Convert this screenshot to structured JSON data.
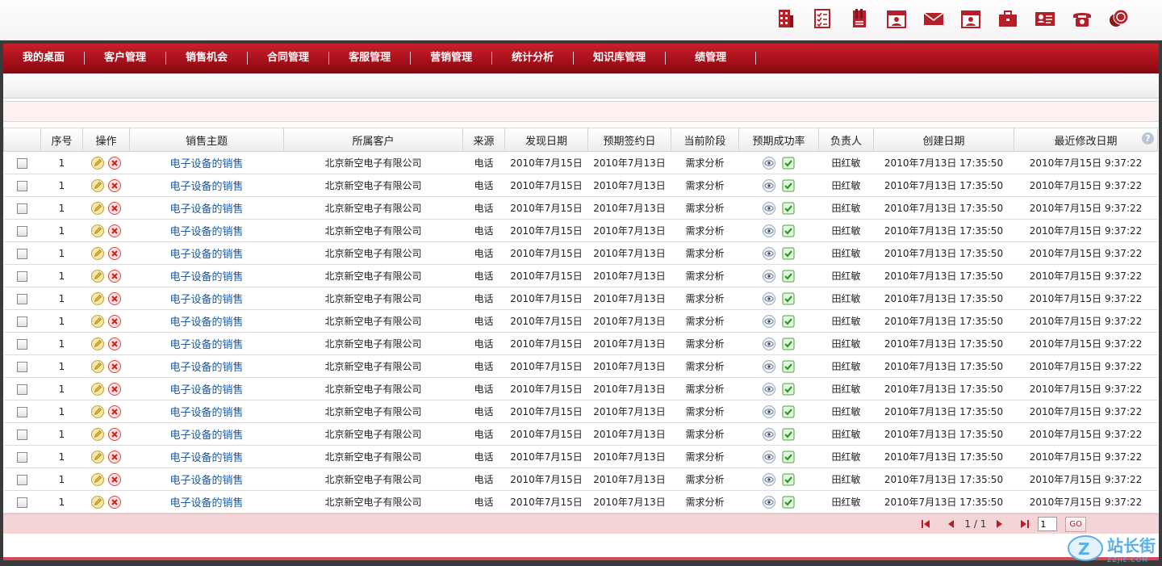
{
  "top_icons": [
    "building-icon",
    "checklist-icon",
    "document-icon",
    "calendar-user-icon",
    "mail-icon",
    "calendar-contact-icon",
    "briefcase-icon",
    "id-card-icon",
    "telephone-icon",
    "coins-icon"
  ],
  "nav": {
    "items": [
      "我的桌面",
      "客户管理",
      "销售机会",
      "合同管理",
      "客服管理",
      "营销管理",
      "统计分析",
      "知识库管理",
      "绩管理"
    ]
  },
  "grid": {
    "headers": [
      "序号",
      "操作",
      "销售主题",
      "所属客户",
      "来源",
      "发现日期",
      "预期签约日",
      "当前阶段",
      "预期成功率",
      "负责人",
      "创建日期",
      "最近修改日期"
    ],
    "help_label": "?",
    "rows": [
      {
        "seq": "1",
        "subject": "电子设备的销售",
        "customer": "北京新空电子有限公司",
        "source": "电话",
        "found": "2010年7月15日",
        "expected": "2010年7月13日",
        "stage": "需求分析",
        "owner": "田红敏",
        "created": "2010年7月13日 17:35:50",
        "modified": "2010年7月15日 9:37:22"
      },
      {
        "seq": "1",
        "subject": "电子设备的销售",
        "customer": "北京新空电子有限公司",
        "source": "电话",
        "found": "2010年7月15日",
        "expected": "2010年7月13日",
        "stage": "需求分析",
        "owner": "田红敏",
        "created": "2010年7月13日 17:35:50",
        "modified": "2010年7月15日 9:37:22"
      },
      {
        "seq": "1",
        "subject": "电子设备的销售",
        "customer": "北京新空电子有限公司",
        "source": "电话",
        "found": "2010年7月15日",
        "expected": "2010年7月13日",
        "stage": "需求分析",
        "owner": "田红敏",
        "created": "2010年7月13日 17:35:50",
        "modified": "2010年7月15日 9:37:22"
      },
      {
        "seq": "1",
        "subject": "电子设备的销售",
        "customer": "北京新空电子有限公司",
        "source": "电话",
        "found": "2010年7月15日",
        "expected": "2010年7月13日",
        "stage": "需求分析",
        "owner": "田红敏",
        "created": "2010年7月13日 17:35:50",
        "modified": "2010年7月15日 9:37:22"
      },
      {
        "seq": "1",
        "subject": "电子设备的销售",
        "customer": "北京新空电子有限公司",
        "source": "电话",
        "found": "2010年7月15日",
        "expected": "2010年7月13日",
        "stage": "需求分析",
        "owner": "田红敏",
        "created": "2010年7月13日 17:35:50",
        "modified": "2010年7月15日 9:37:22"
      },
      {
        "seq": "1",
        "subject": "电子设备的销售",
        "customer": "北京新空电子有限公司",
        "source": "电话",
        "found": "2010年7月15日",
        "expected": "2010年7月13日",
        "stage": "需求分析",
        "owner": "田红敏",
        "created": "2010年7月13日 17:35:50",
        "modified": "2010年7月15日 9:37:22"
      },
      {
        "seq": "1",
        "subject": "电子设备的销售",
        "customer": "北京新空电子有限公司",
        "source": "电话",
        "found": "2010年7月15日",
        "expected": "2010年7月13日",
        "stage": "需求分析",
        "owner": "田红敏",
        "created": "2010年7月13日 17:35:50",
        "modified": "2010年7月15日 9:37:22"
      },
      {
        "seq": "1",
        "subject": "电子设备的销售",
        "customer": "北京新空电子有限公司",
        "source": "电话",
        "found": "2010年7月15日",
        "expected": "2010年7月13日",
        "stage": "需求分析",
        "owner": "田红敏",
        "created": "2010年7月13日 17:35:50",
        "modified": "2010年7月15日 9:37:22"
      },
      {
        "seq": "1",
        "subject": "电子设备的销售",
        "customer": "北京新空电子有限公司",
        "source": "电话",
        "found": "2010年7月15日",
        "expected": "2010年7月13日",
        "stage": "需求分析",
        "owner": "田红敏",
        "created": "2010年7月13日 17:35:50",
        "modified": "2010年7月15日 9:37:22"
      },
      {
        "seq": "1",
        "subject": "电子设备的销售",
        "customer": "北京新空电子有限公司",
        "source": "电话",
        "found": "2010年7月15日",
        "expected": "2010年7月13日",
        "stage": "需求分析",
        "owner": "田红敏",
        "created": "2010年7月13日 17:35:50",
        "modified": "2010年7月15日 9:37:22"
      },
      {
        "seq": "1",
        "subject": "电子设备的销售",
        "customer": "北京新空电子有限公司",
        "source": "电话",
        "found": "2010年7月15日",
        "expected": "2010年7月13日",
        "stage": "需求分析",
        "owner": "田红敏",
        "created": "2010年7月13日 17:35:50",
        "modified": "2010年7月15日 9:37:22"
      },
      {
        "seq": "1",
        "subject": "电子设备的销售",
        "customer": "北京新空电子有限公司",
        "source": "电话",
        "found": "2010年7月15日",
        "expected": "2010年7月13日",
        "stage": "需求分析",
        "owner": "田红敏",
        "created": "2010年7月13日 17:35:50",
        "modified": "2010年7月15日 9:37:22"
      },
      {
        "seq": "1",
        "subject": "电子设备的销售",
        "customer": "北京新空电子有限公司",
        "source": "电话",
        "found": "2010年7月15日",
        "expected": "2010年7月13日",
        "stage": "需求分析",
        "owner": "田红敏",
        "created": "2010年7月13日 17:35:50",
        "modified": "2010年7月15日 9:37:22"
      },
      {
        "seq": "1",
        "subject": "电子设备的销售",
        "customer": "北京新空电子有限公司",
        "source": "电话",
        "found": "2010年7月15日",
        "expected": "2010年7月13日",
        "stage": "需求分析",
        "owner": "田红敏",
        "created": "2010年7月13日 17:35:50",
        "modified": "2010年7月15日 9:37:22"
      },
      {
        "seq": "1",
        "subject": "电子设备的销售",
        "customer": "北京新空电子有限公司",
        "source": "电话",
        "found": "2010年7月15日",
        "expected": "2010年7月13日",
        "stage": "需求分析",
        "owner": "田红敏",
        "created": "2010年7月13日 17:35:50",
        "modified": "2010年7月15日 9:37:22"
      },
      {
        "seq": "1",
        "subject": "电子设备的销售",
        "customer": "北京新空电子有限公司",
        "source": "电话",
        "found": "2010年7月15日",
        "expected": "2010年7月13日",
        "stage": "需求分析",
        "owner": "田红敏",
        "created": "2010年7月13日 17:35:50",
        "modified": "2010年7月15日 9:37:22"
      }
    ]
  },
  "pager": {
    "current": "1",
    "separator": "/",
    "total": "1",
    "input_value": "1",
    "go_label": "GO"
  },
  "watermark": {
    "text": "站长街",
    "sub": "ZZJIE.COM"
  },
  "colors": {
    "nav_red": "#a8111c",
    "link_blue": "#1a5aa0",
    "pager_bg": "#f3d5d7"
  }
}
